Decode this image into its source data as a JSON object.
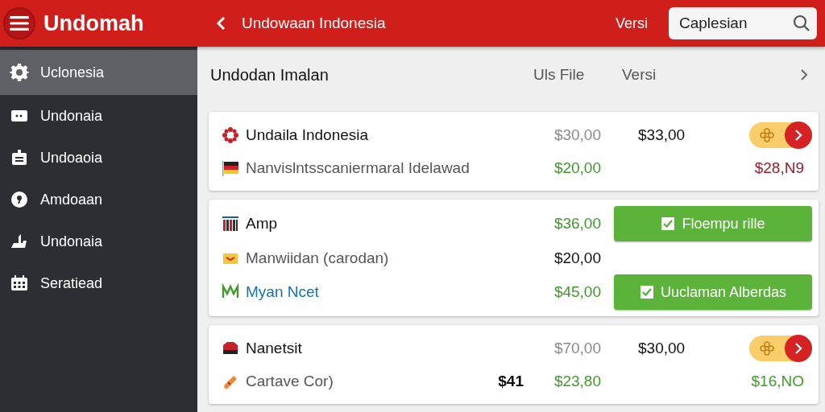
{
  "app_bar": {
    "brand": "Undomah",
    "title": "Undowaan Indonesia",
    "version_link": "Versi",
    "search": {
      "value": "Caplesian"
    }
  },
  "sidebar": {
    "items": [
      {
        "label": "Uclonesia",
        "selected": true
      },
      {
        "label": "Undonaia",
        "selected": false
      },
      {
        "label": "Undoaoia",
        "selected": false
      },
      {
        "label": "Amdoaan",
        "selected": false
      },
      {
        "label": "Undonaia",
        "selected": false
      },
      {
        "label": "Seratiead",
        "selected": false
      }
    ]
  },
  "list_header": {
    "title": "Undodan Imalan",
    "column_1": "Uls File",
    "column_2": "Versi"
  },
  "cards": [
    {
      "rows": [
        {
          "name": "Undaila Indonesia",
          "color": "#111111",
          "price_1": {
            "text": "$30,00",
            "color": "#8a8a8a"
          },
          "price_2": {
            "text": "$33,00",
            "color": "#111111"
          },
          "action": {
            "kind": "pill"
          }
        },
        {
          "name": "Nanvislntsscaniermaral Idelawad",
          "color": "#555555",
          "price_1": {
            "text": "$20,00",
            "color": "#3f9a2a"
          },
          "action": {
            "kind": "amount",
            "text": "$28,N9",
            "color": "#9b1b2a"
          }
        }
      ]
    },
    {
      "rows": [
        {
          "name": "Amp",
          "color": "#111111",
          "price_1": {
            "text": "$36,00",
            "color": "#3f9a2a"
          },
          "action": {
            "kind": "button",
            "text": "Floempu rille",
            "checked": true
          }
        },
        {
          "name": "Manwiidan (carodan)",
          "color": "#555555",
          "price_1": {
            "text": "$20,00",
            "color": "#111111"
          }
        },
        {
          "name": "Myan Ncet",
          "color": "#1673a8",
          "price_1": {
            "text": "$45,00",
            "color": "#3f9a2a"
          },
          "action": {
            "kind": "button",
            "text": "Uuclaman Alberdas",
            "checked": true
          }
        }
      ]
    },
    {
      "rows": [
        {
          "name": "Nanetsit",
          "color": "#111111",
          "price_1": {
            "text": "$70,00",
            "color": "#8a8a8a"
          },
          "price_2": {
            "text": "$30,00",
            "color": "#111111"
          },
          "action": {
            "kind": "pill"
          }
        },
        {
          "name": "Cartave Cor)",
          "color": "#555555",
          "extra": "$41",
          "price_1": {
            "text": "$23,80",
            "color": "#3f9a2a"
          },
          "action": {
            "kind": "amount",
            "text": "$16,NO",
            "color": "#3f9a2a"
          }
        }
      ]
    }
  ]
}
